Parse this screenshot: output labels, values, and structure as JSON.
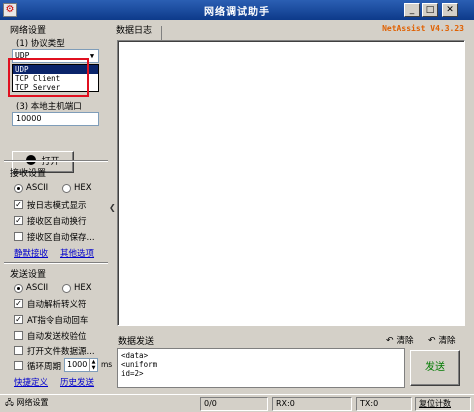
{
  "window": {
    "title": "网络调试助手",
    "version": "NetAssist V4.3.23"
  },
  "net_settings": {
    "group_title": "网络设置",
    "protocol_label": "(1) 协议类型",
    "protocol_selected": "UDP",
    "protocol_options": [
      "UDP",
      "TCP Client",
      "TCP Server"
    ],
    "host_port_label": "(3) 本地主机端口",
    "port_value": "10000",
    "open_label": "打开"
  },
  "recv_settings": {
    "group_title": "接收设置",
    "ascii_label": "ASCII",
    "hex_label": "HEX",
    "opt_log_mode": "按日志模式显示",
    "opt_auto_wrap": "接收区自动换行",
    "opt_save": "接收区自动保存...",
    "link_mute": "静默接收",
    "link_more": "其他选项"
  },
  "send_settings": {
    "group_title": "发送设置",
    "ascii_label": "ASCII",
    "hex_label": "HEX",
    "opt_escape": "自动解析转义符",
    "opt_at": "AT指令自动回车",
    "opt_checksum": "自动发送校验位",
    "opt_file": "打开文件数据源...",
    "opt_loop": "循环周期",
    "loop_value": "1000",
    "loop_unit": "ms",
    "link_shortcut": "快捷定义",
    "link_history": "历史发送"
  },
  "log": {
    "tab_label": "数据日志"
  },
  "send": {
    "tab_label": "数据发送",
    "clear1": "清除",
    "clear2": "清除",
    "content": "<data>\n<uniform\nid=2>",
    "send_label": "发送"
  },
  "status": {
    "settings": "网络设置",
    "count0": "0/0",
    "rx": "RX:0",
    "tx": "TX:0",
    "reset": "复位计数"
  }
}
